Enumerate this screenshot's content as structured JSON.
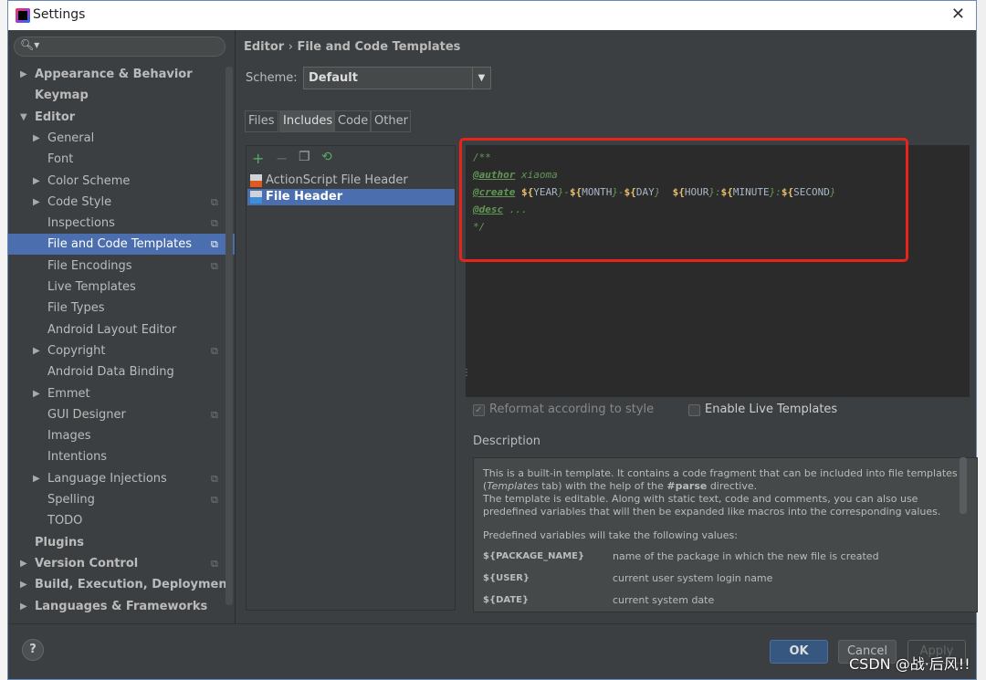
{
  "window": {
    "title": "Settings"
  },
  "sidebar": {
    "items": [
      {
        "label": "Appearance & Behavior",
        "level": 0,
        "bold": true,
        "arrow": "right"
      },
      {
        "label": "Keymap",
        "level": 0,
        "bold": true
      },
      {
        "label": "Editor",
        "level": 0,
        "bold": true,
        "arrow": "down"
      },
      {
        "label": "General",
        "level": 1,
        "arrow": "right"
      },
      {
        "label": "Font",
        "level": 1
      },
      {
        "label": "Color Scheme",
        "level": 1,
        "arrow": "right"
      },
      {
        "label": "Code Style",
        "level": 1,
        "arrow": "right",
        "copy": true
      },
      {
        "label": "Inspections",
        "level": 1,
        "copy": true
      },
      {
        "label": "File and Code Templates",
        "level": 1,
        "copy": true,
        "selected": true
      },
      {
        "label": "File Encodings",
        "level": 1,
        "copy": true
      },
      {
        "label": "Live Templates",
        "level": 1
      },
      {
        "label": "File Types",
        "level": 1
      },
      {
        "label": "Android Layout Editor",
        "level": 1
      },
      {
        "label": "Copyright",
        "level": 1,
        "arrow": "right",
        "copy": true
      },
      {
        "label": "Android Data Binding",
        "level": 1
      },
      {
        "label": "Emmet",
        "level": 1,
        "arrow": "right"
      },
      {
        "label": "GUI Designer",
        "level": 1,
        "copy": true
      },
      {
        "label": "Images",
        "level": 1
      },
      {
        "label": "Intentions",
        "level": 1
      },
      {
        "label": "Language Injections",
        "level": 1,
        "arrow": "right",
        "copy": true
      },
      {
        "label": "Spelling",
        "level": 1,
        "copy": true
      },
      {
        "label": "TODO",
        "level": 1
      },
      {
        "label": "Plugins",
        "level": 0,
        "bold": true
      },
      {
        "label": "Version Control",
        "level": 0,
        "bold": true,
        "arrow": "right",
        "copy": true
      },
      {
        "label": "Build, Execution, Deployment",
        "level": 0,
        "bold": true,
        "arrow": "right"
      },
      {
        "label": "Languages & Frameworks",
        "level": 0,
        "bold": true,
        "arrow": "right"
      }
    ]
  },
  "breadcrumb": {
    "parent": "Editor",
    "sep": "›",
    "current": "File and Code Templates"
  },
  "scheme": {
    "label": "Scheme:",
    "value": "Default"
  },
  "tabs": [
    "Files",
    "Includes",
    "Code",
    "Other"
  ],
  "selected_tab": "Includes",
  "templates": [
    {
      "name": "ActionScript File Header",
      "badge": "AS"
    },
    {
      "name": "File Header",
      "selected": true
    }
  ],
  "editor": {
    "l1": "/**",
    "author_tag": "@author",
    "author_val": " xiaoma",
    "create_tag": "@create",
    "create_parts": [
      "${",
      "YEAR",
      "}-",
      "${",
      "MONTH",
      "}-",
      "${",
      "DAY",
      "}  ",
      "${",
      "HOUR",
      "}:",
      "${",
      "MINUTE",
      "}:",
      "${",
      "SECOND",
      "}"
    ],
    "desc_tag": "@desc",
    "desc_val": " ...",
    "l5": "*/"
  },
  "options": {
    "reformat": {
      "label": "Reformat according to style",
      "checked": true,
      "enabled": false
    },
    "live": {
      "label": "Enable Live Templates",
      "checked": false
    }
  },
  "description": {
    "label": "Description",
    "p1a": "This is a built-in template. It contains a code fragment that can be included into file templates (",
    "p1i": "Templates",
    "p1b": " tab) with the help of the ",
    "p1c": "#parse",
    "p1d": " directive.",
    "p2": "The template is editable. Along with static text, code and comments, you can also use predefined variables that will then be expanded like macros into the corresponding values.",
    "p3": "Predefined variables will take the following values:",
    "vars": [
      {
        "name": "${PACKAGE_NAME}",
        "desc": "name of the package in which the new file is created"
      },
      {
        "name": "${USER}",
        "desc": "current user system login name"
      },
      {
        "name": "${DATE}",
        "desc": "current system date"
      }
    ]
  },
  "buttons": {
    "help": "?",
    "ok": "OK",
    "cancel": "Cancel",
    "apply": "Apply"
  },
  "watermark": "CSDN @战·后风!!"
}
